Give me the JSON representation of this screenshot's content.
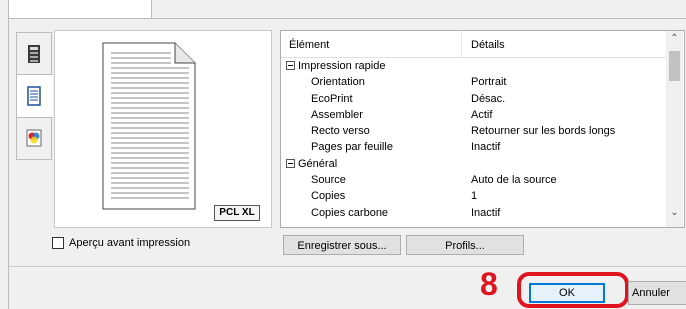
{
  "vtabs": [
    {
      "icon": "printer-tray-icon",
      "selected": false
    },
    {
      "icon": "document-layout-icon",
      "selected": true
    },
    {
      "icon": "color-icon",
      "selected": false
    }
  ],
  "preview": {
    "badge": "PCL XL"
  },
  "grid": {
    "col_element": "Élément",
    "col_details": "Détails",
    "rows": [
      {
        "type": "group",
        "label": "Impression rapide"
      },
      {
        "type": "item",
        "label": "Orientation",
        "value": "Portrait"
      },
      {
        "type": "item",
        "label": "EcoPrint",
        "value": "Désac."
      },
      {
        "type": "item",
        "label": "Assembler",
        "value": "Actif"
      },
      {
        "type": "item",
        "label": "Recto verso",
        "value": "Retourner sur les bords longs"
      },
      {
        "type": "item",
        "label": "Pages par feuille",
        "value": "Inactif"
      },
      {
        "type": "group",
        "label": "Général"
      },
      {
        "type": "item",
        "label": "Source",
        "value": "Auto de la source"
      },
      {
        "type": "item",
        "label": "Copies",
        "value": "1"
      },
      {
        "type": "item",
        "label": "Copies carbone",
        "value": "Inactif"
      }
    ]
  },
  "preview_checkbox": {
    "label": "Aperçu avant impression",
    "checked": false
  },
  "buttons": {
    "save_as": "Enregistrer sous...",
    "profiles": "Profils...",
    "ok": "OK",
    "cancel": "Annuler"
  },
  "annotation": {
    "step": "8",
    "color": "#e0141e"
  }
}
